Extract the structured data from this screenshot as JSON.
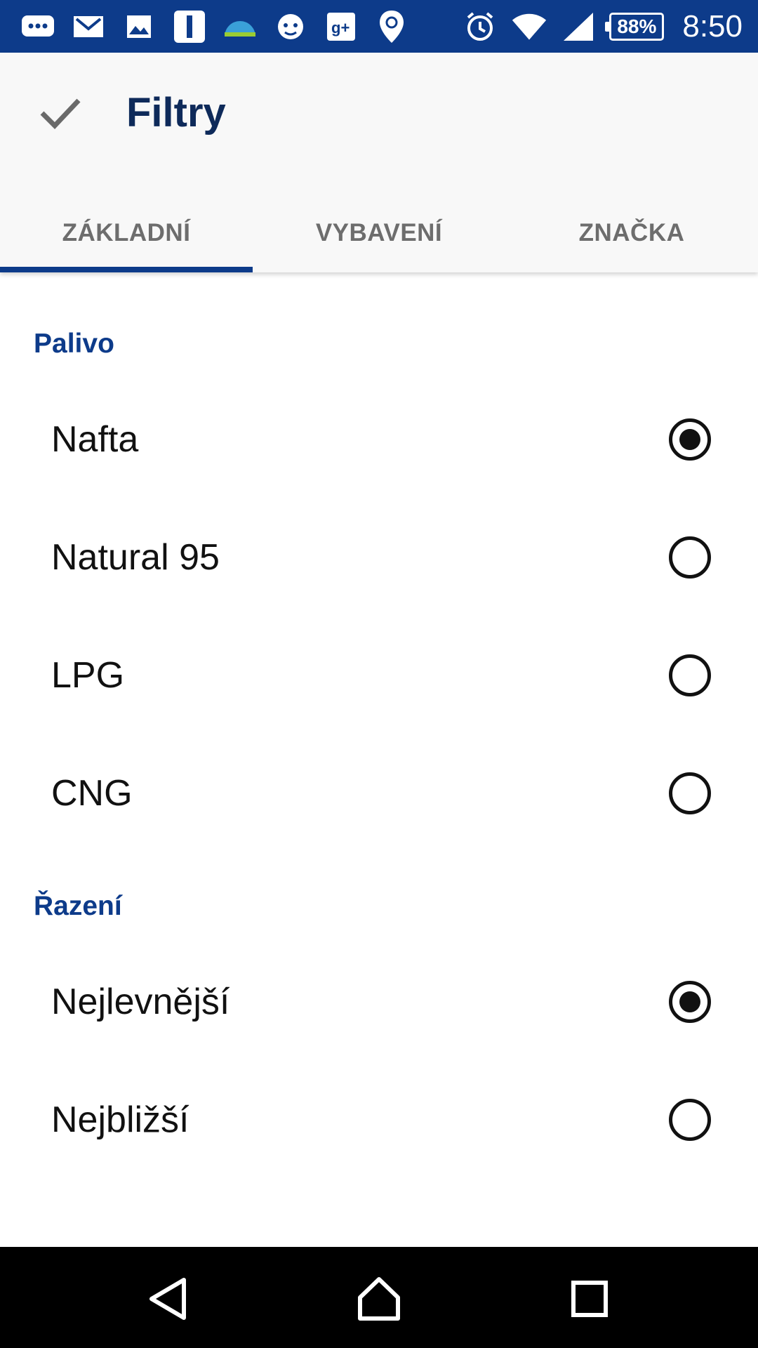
{
  "status_bar": {
    "left_icons": [
      "messages-icon",
      "gmail-icon",
      "gallery-icon",
      "app-i-icon",
      "weather-icon",
      "android-icon",
      "google-plus-icon",
      "location-pin-icon"
    ],
    "battery": "88%",
    "time": "8:50"
  },
  "app_bar": {
    "title": "Filtry",
    "confirm_icon": "check-icon"
  },
  "tabs": [
    {
      "label": "ZÁKLADNÍ",
      "active": true
    },
    {
      "label": "VYBAVENÍ",
      "active": false
    },
    {
      "label": "ZNAČKA",
      "active": false
    }
  ],
  "fuel": {
    "title": "Palivo",
    "options": [
      {
        "label": "Nafta",
        "selected": true
      },
      {
        "label": "Natural 95",
        "selected": false
      },
      {
        "label": "LPG",
        "selected": false
      },
      {
        "label": "CNG",
        "selected": false
      }
    ]
  },
  "sorting": {
    "title": "Řazení",
    "options": [
      {
        "label": "Nejlevnější",
        "selected": true
      },
      {
        "label": "Nejbližší",
        "selected": false
      }
    ]
  },
  "colors": {
    "accent": "#0d3b8a",
    "title": "#0e2a5a"
  }
}
